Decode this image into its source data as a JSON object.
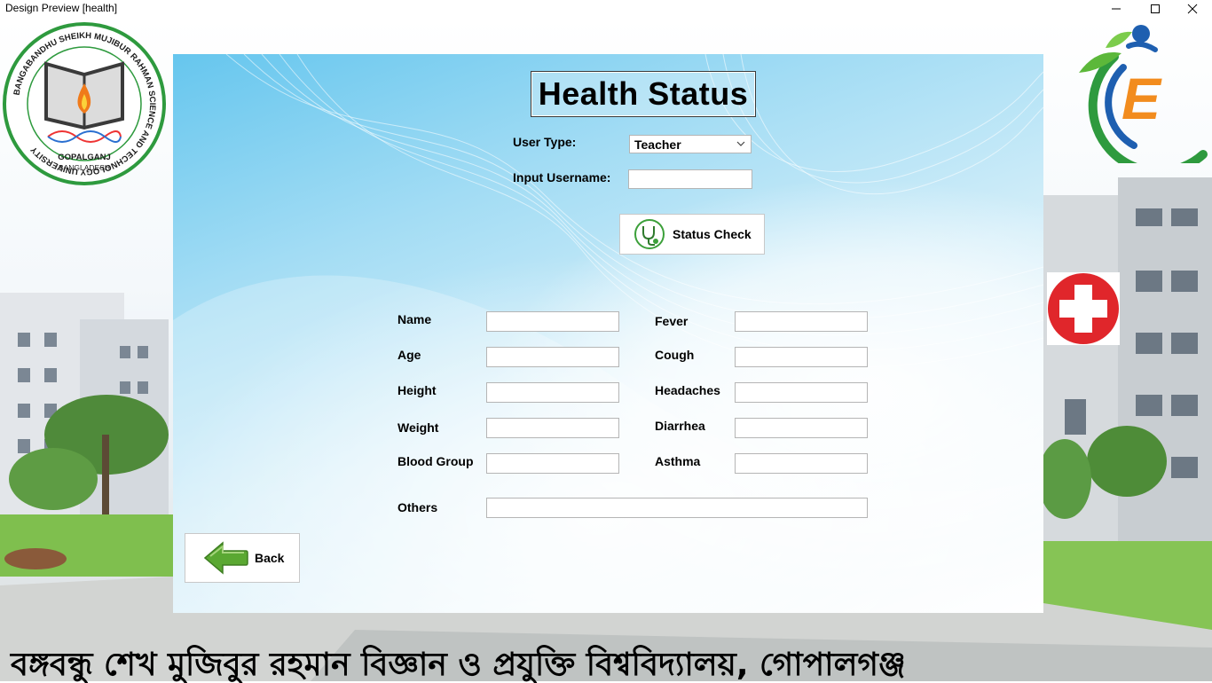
{
  "window": {
    "title": "Design Preview [health]",
    "minimize_icon": "minimize-icon",
    "maximize_icon": "maximize-icon",
    "close_icon": "close-icon"
  },
  "logos": {
    "university_top_text": "BANGABANDHU SHEIKH MUJIBUR RAHMAN SCIENCE AND TECHNOLOGY UNIVERSITY",
    "university_place": "GOPALGANJ",
    "university_country": "BANGLADESH",
    "app_logo_letter": "E"
  },
  "page": {
    "heading": "Health Status"
  },
  "form": {
    "user_type_label": "User Type:",
    "user_type_value": "Teacher",
    "username_label": "Input Username:",
    "username_value": "",
    "status_check_label": "Status Check"
  },
  "details": {
    "name_label": "Name",
    "age_label": "Age",
    "height_label": "Height",
    "weight_label": "Weight",
    "blood_group_label": "Blood Group",
    "fever_label": "Fever",
    "cough_label": "Cough",
    "headaches_label": "Headaches",
    "diarrhea_label": "Diarrhea",
    "asthma_label": "Asthma",
    "others_label": "Others"
  },
  "nav": {
    "back_label": "Back"
  },
  "footer": {
    "bangla_title": "বঙ্গবন্ধু শেখ মুজিবুর রহমান বিজ্ঞান ও প্রযুক্তি বিশ্ববিদ্যালয়, গোপালগঞ্জ"
  },
  "colors": {
    "logo_green": "#2e9a3e",
    "logo_orange": "#f28c1e",
    "logo_blue": "#1e5fb0",
    "medical_red": "#e0262b",
    "back_arrow_green": "#5aa832",
    "panel_blue": "#66c6ee"
  }
}
